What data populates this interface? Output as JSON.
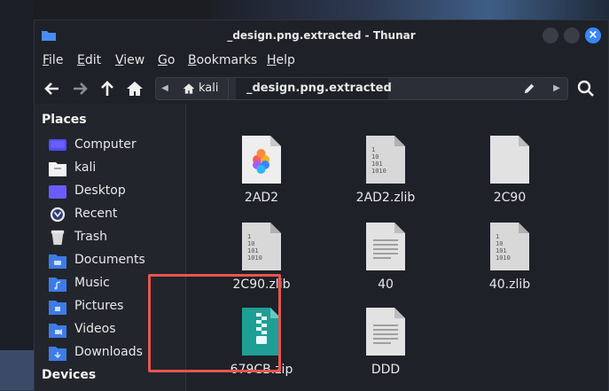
{
  "window": {
    "title": "_design.png.extracted - Thunar"
  },
  "menubar": [
    "File",
    "Edit",
    "View",
    "Go",
    "Bookmarks",
    "Help"
  ],
  "menubar_mnemonics": [
    "F",
    "E",
    "V",
    "G",
    "B",
    "H"
  ],
  "path": {
    "crumb_home": "kali",
    "crumb_current": "_design.png.extracted"
  },
  "sidebar": {
    "places_header": "Places",
    "items": [
      {
        "label": "Computer",
        "icon": "computer-icon"
      },
      {
        "label": "kali",
        "icon": "home-folder-icon"
      },
      {
        "label": "Desktop",
        "icon": "desktop-icon"
      },
      {
        "label": "Recent",
        "icon": "recent-icon"
      },
      {
        "label": "Trash",
        "icon": "trash-icon"
      },
      {
        "label": "Documents",
        "icon": "documents-icon"
      },
      {
        "label": "Music",
        "icon": "music-icon"
      },
      {
        "label": "Pictures",
        "icon": "pictures-icon"
      },
      {
        "label": "Videos",
        "icon": "videos-icon"
      },
      {
        "label": "Downloads",
        "icon": "downloads-icon"
      }
    ],
    "devices_header": "Devices"
  },
  "files": [
    {
      "name": "2AD2",
      "type": "image"
    },
    {
      "name": "2AD2.zlib",
      "type": "binary"
    },
    {
      "name": "2C90",
      "type": "blank"
    },
    {
      "name": "2C90.zlib",
      "type": "binary"
    },
    {
      "name": "40",
      "type": "text"
    },
    {
      "name": "40.zlib",
      "type": "binary"
    },
    {
      "name": "679CB.zip",
      "type": "zip"
    },
    {
      "name": "DDD",
      "type": "text"
    }
  ],
  "colors": {
    "accent": "#3a86ff",
    "highlight": "#e8554e"
  }
}
